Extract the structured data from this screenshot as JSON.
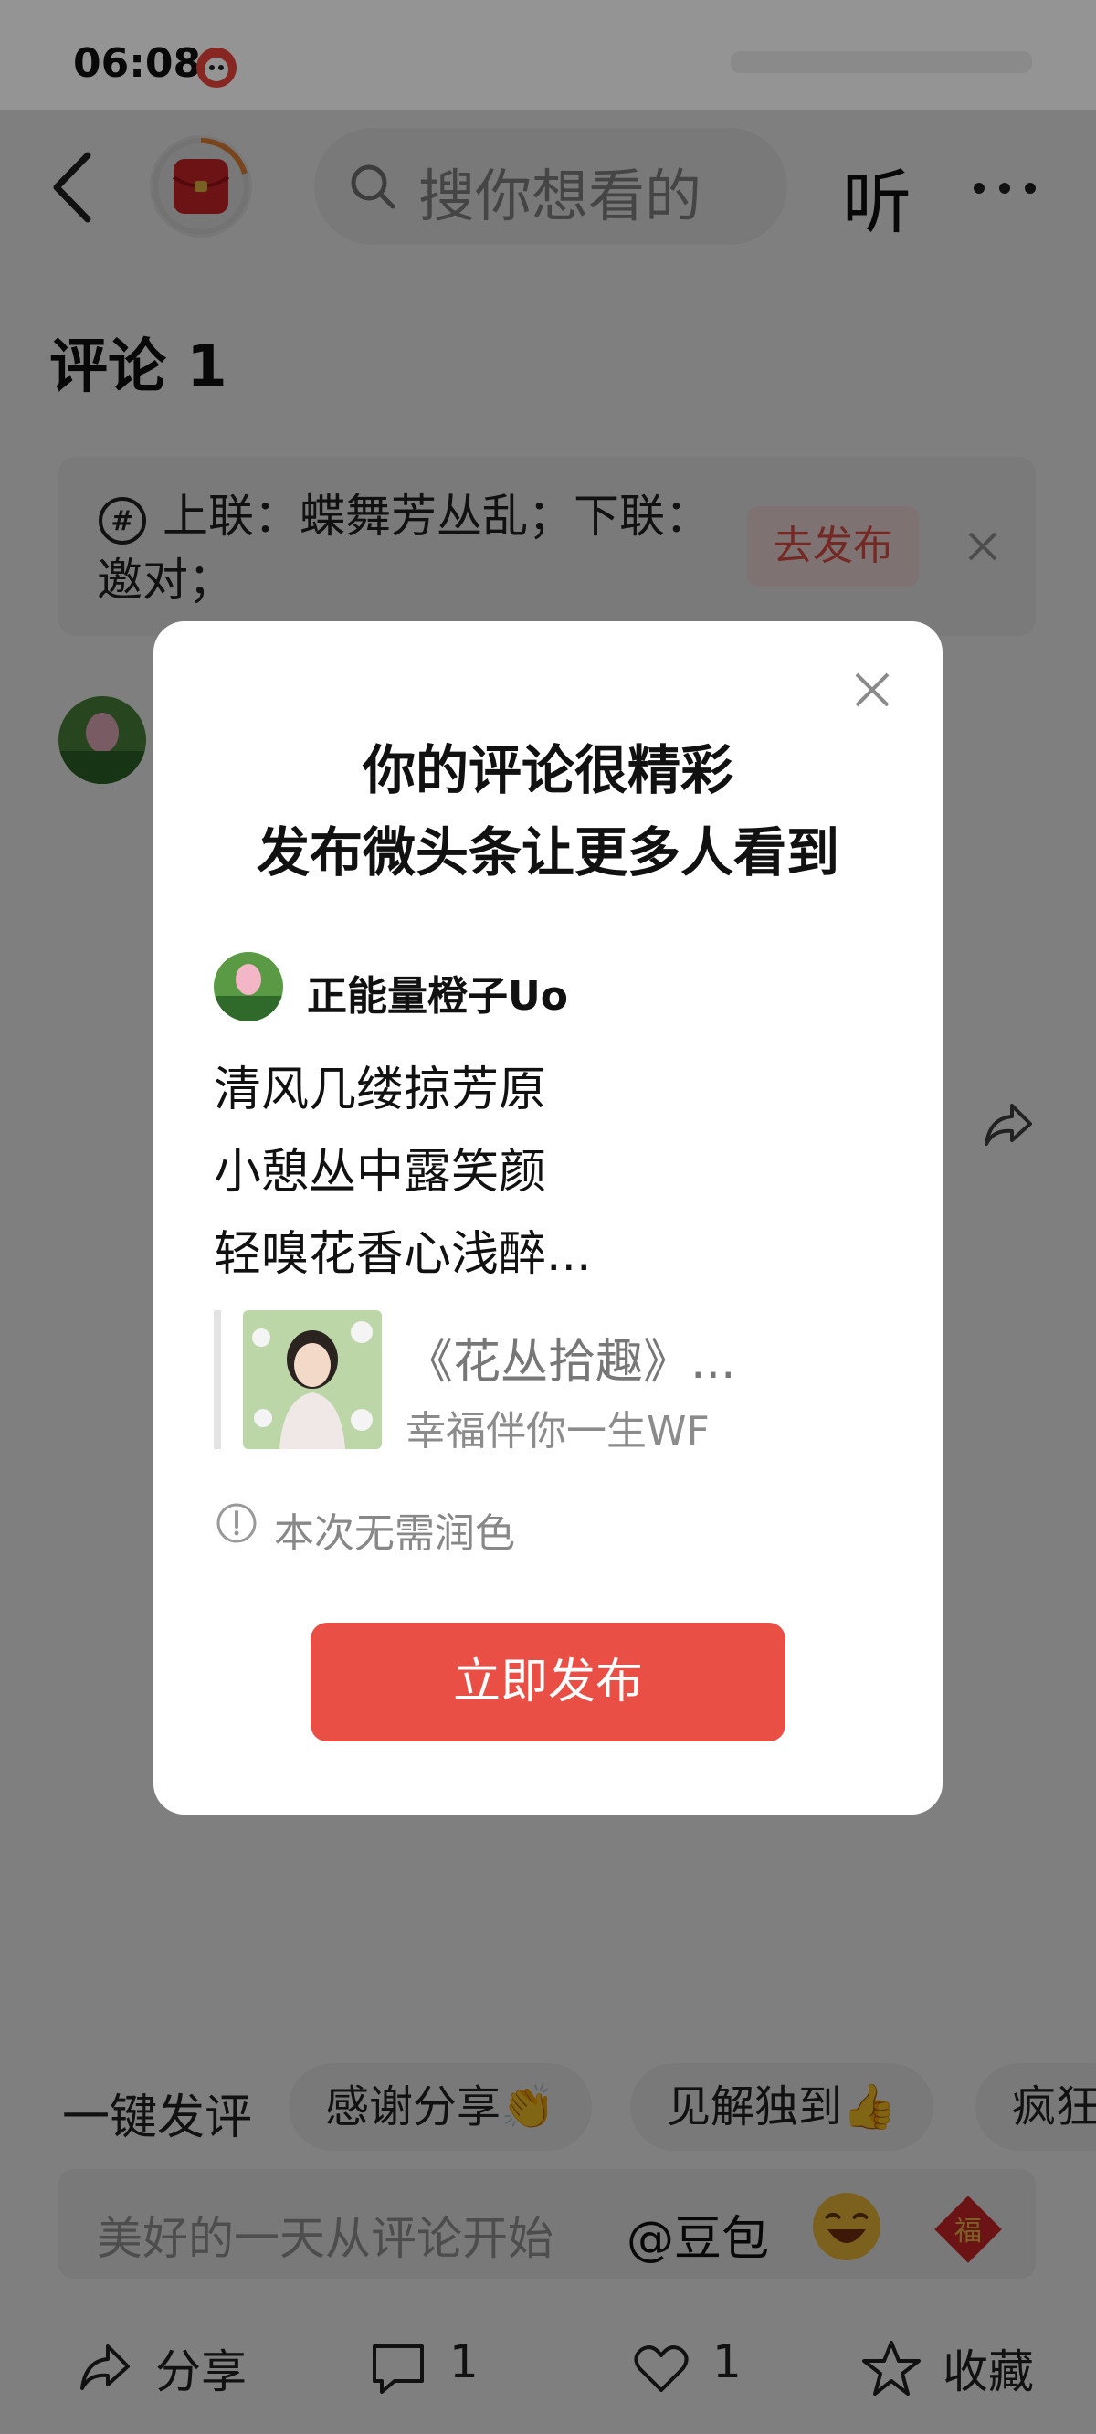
{
  "status_bar": {
    "time": "06:08"
  },
  "header": {
    "search_placeholder": "搜你想看的",
    "listen_label": "听"
  },
  "comments": {
    "title": "评论 1"
  },
  "banner": {
    "text": "上联：蝶舞芳丛乱；下联：邀对；",
    "button": "去发布"
  },
  "modal": {
    "title_line1": "你的评论很精彩",
    "title_line2": "发布微头条让更多人看到",
    "author": "正能量橙子Uo",
    "lines": [
      "清风几缕掠芳原",
      "小憩丛中露笑颜",
      "轻嗅花香心浅醉..."
    ],
    "quote_title": "《花丛拾趣》...",
    "quote_author": "幸福伴你一生WF",
    "notice": "本次无需润色",
    "publish_button": "立即发布"
  },
  "quick_reply": {
    "label": "一键发评",
    "chips": [
      "感谢分享👏",
      "见解独到👍",
      "疯狂"
    ]
  },
  "input": {
    "placeholder": "美好的一天从评论开始",
    "at_label": "@豆包"
  },
  "bottom_bar": {
    "share": "分享",
    "comments": "1",
    "likes": "1",
    "favorite": "收藏"
  },
  "colors": {
    "accent": "#ea4f45",
    "overlay": "rgba(0,0,0,0.5)"
  }
}
